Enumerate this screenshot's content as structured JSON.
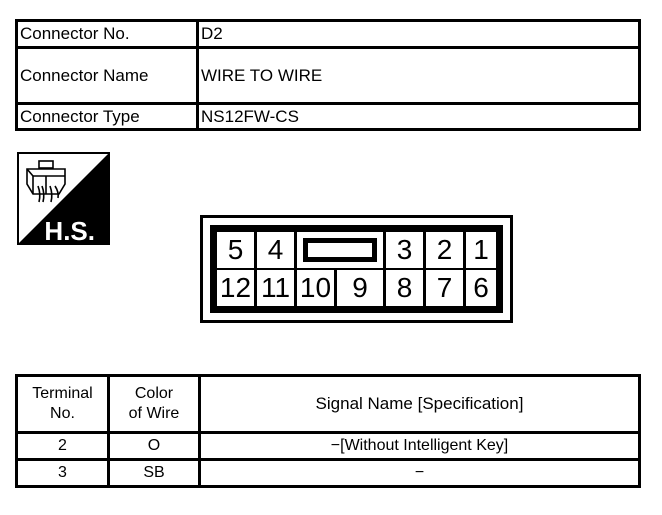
{
  "connector_info": {
    "rows": [
      {
        "label": "Connector No.",
        "value": "D2"
      },
      {
        "label": "Connector Name",
        "value": "WIRE TO WIRE"
      },
      {
        "label": "Connector Type",
        "value": "NS12FW-CS"
      }
    ]
  },
  "hs_icon": {
    "icon": "harness-side-connector-icon",
    "label": "H.S."
  },
  "connector_face": {
    "top_row": [
      "5",
      "4",
      "KEY",
      "3",
      "2",
      "1"
    ],
    "bottom_row": [
      "12",
      "11",
      "10",
      "9",
      "8",
      "7",
      "6"
    ]
  },
  "terminal_table": {
    "headers": {
      "terminal_no_line1": "Terminal",
      "terminal_no_line2": "No.",
      "wire_color_line1": "Color",
      "wire_color_line2": "of Wire",
      "signal": "Signal Name [Specification]"
    },
    "rows": [
      {
        "terminal": "2",
        "color": "O",
        "signal": "−[Without Intelligent Key]"
      },
      {
        "terminal": "3",
        "color": "SB",
        "signal": "−"
      }
    ]
  }
}
